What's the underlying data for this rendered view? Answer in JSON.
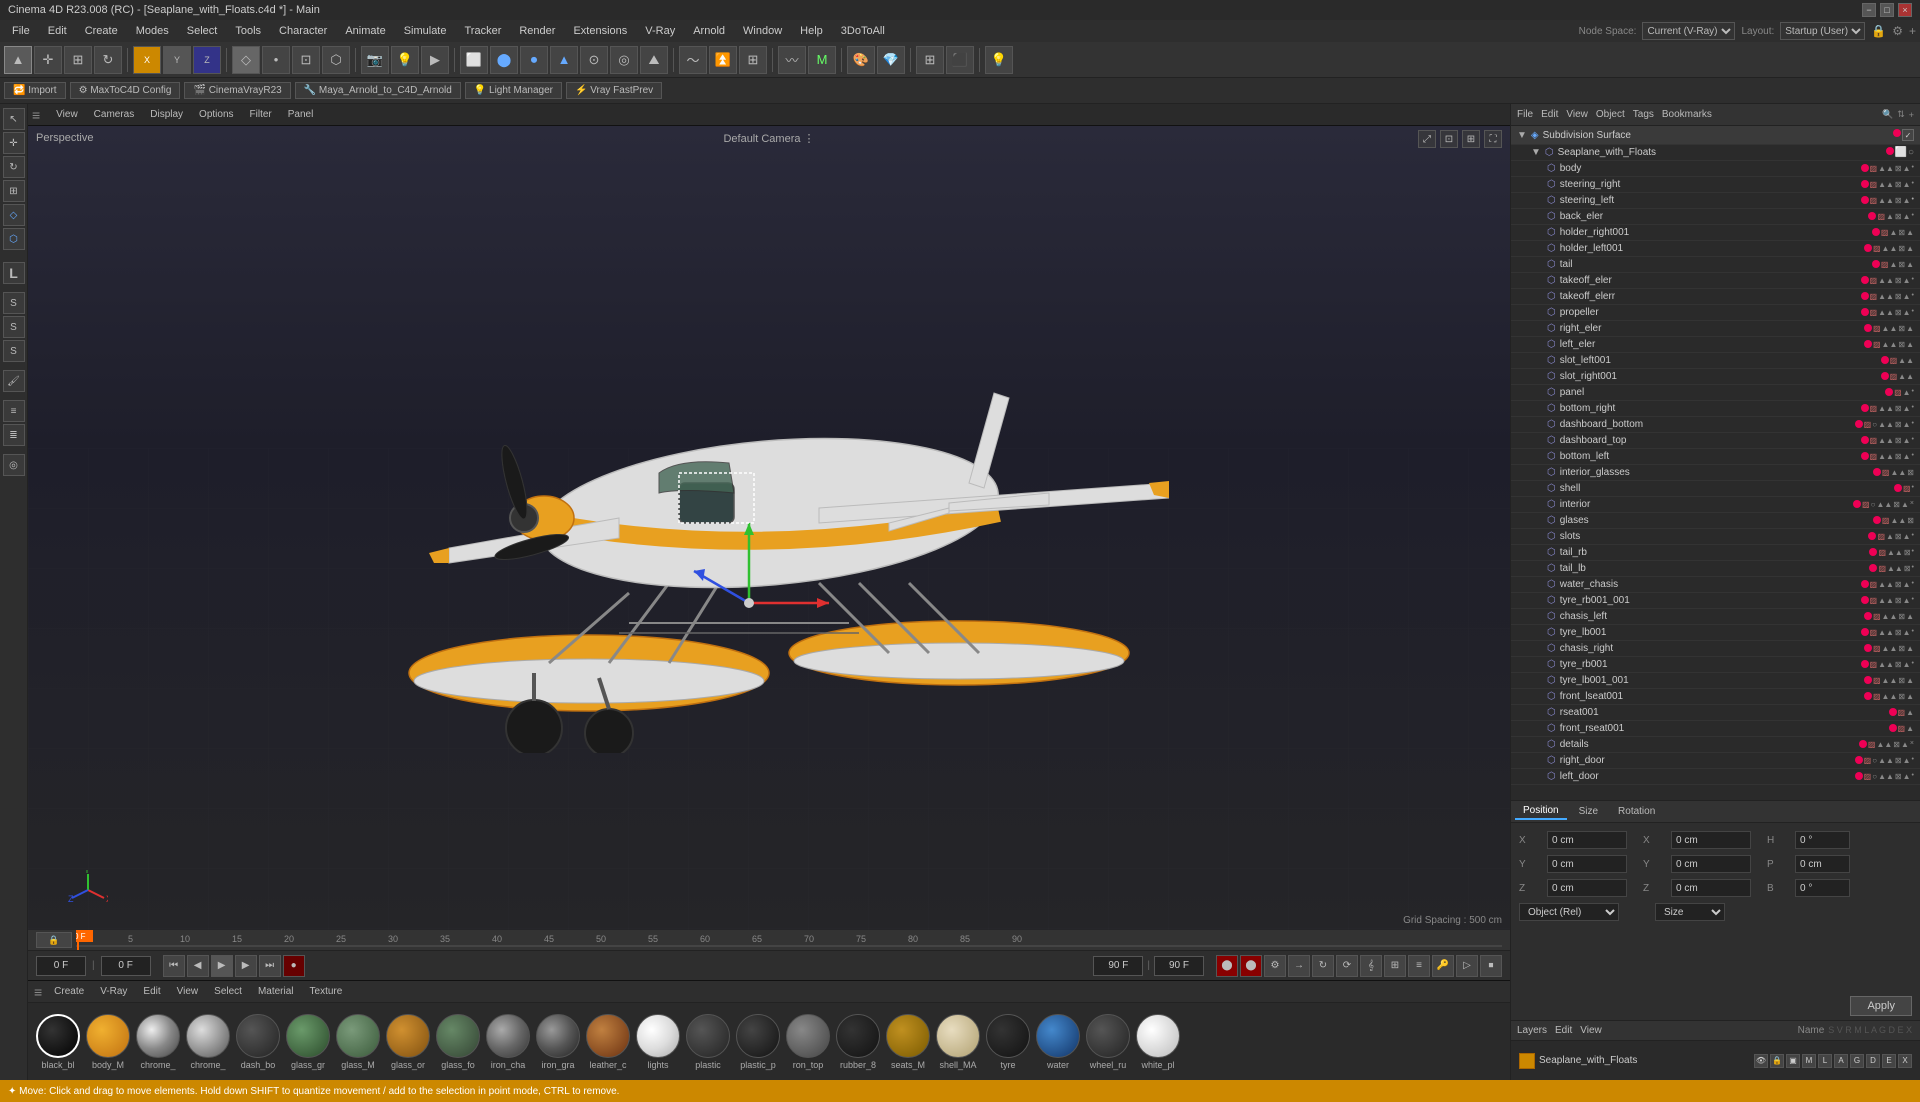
{
  "titlebar": {
    "title": "Cinema 4D R23.008 (RC) - [Seaplane_with_Floats.c4d *] - Main",
    "min": "−",
    "max": "□",
    "close": "×"
  },
  "menubar": {
    "items": [
      "File",
      "Edit",
      "Create",
      "Modes",
      "Select",
      "Tools",
      "Character",
      "Animate",
      "Simulate",
      "Tracker",
      "Render",
      "Extensions",
      "V-Ray",
      "Arnold",
      "Window",
      "Help",
      "3DoToAll"
    ]
  },
  "viewport": {
    "perspective": "Perspective",
    "camera": "Default Camera ⋮",
    "grid_spacing": "Grid Spacing : 500 cm",
    "toolbar": [
      "View",
      "Cameras",
      "Display",
      "Options",
      "Filter",
      "Panel"
    ]
  },
  "node_space": {
    "label": "Node Space:",
    "value": "Current (V-Ray)"
  },
  "layout": {
    "value": "Startup (User)"
  },
  "scene_header": {
    "file": "File",
    "edit": "Edit",
    "view": "View",
    "object": "Object",
    "tags": "Tags",
    "bookmarks": "Bookmarks"
  },
  "scene_root": {
    "name": "Subdivision Surface",
    "child": "Seaplane_with_Floats"
  },
  "scene_items": [
    {
      "name": "body",
      "indent": 2
    },
    {
      "name": "steering_right",
      "indent": 2
    },
    {
      "name": "steering_left",
      "indent": 2
    },
    {
      "name": "back_eler",
      "indent": 2
    },
    {
      "name": "holder_right001",
      "indent": 2
    },
    {
      "name": "holder_left001",
      "indent": 2
    },
    {
      "name": "tail",
      "indent": 2
    },
    {
      "name": "takeoff_eler",
      "indent": 2
    },
    {
      "name": "takeoff_elerr",
      "indent": 2
    },
    {
      "name": "propeller",
      "indent": 2
    },
    {
      "name": "right_eler",
      "indent": 2
    },
    {
      "name": "left_eler",
      "indent": 2
    },
    {
      "name": "slot_left001",
      "indent": 2
    },
    {
      "name": "slot_right001",
      "indent": 2
    },
    {
      "name": "panel",
      "indent": 2
    },
    {
      "name": "bottom_right",
      "indent": 2
    },
    {
      "name": "dashboard_bottom",
      "indent": 2
    },
    {
      "name": "dashboard_top",
      "indent": 2
    },
    {
      "name": "bottom_left",
      "indent": 2
    },
    {
      "name": "interior_glasses",
      "indent": 2
    },
    {
      "name": "shell",
      "indent": 2
    },
    {
      "name": "interior",
      "indent": 2
    },
    {
      "name": "glases",
      "indent": 2
    },
    {
      "name": "slots",
      "indent": 2
    },
    {
      "name": "tail_rb",
      "indent": 2
    },
    {
      "name": "tail_lb",
      "indent": 2
    },
    {
      "name": "water_chasis",
      "indent": 2
    },
    {
      "name": "tyre_rb001_001",
      "indent": 2
    },
    {
      "name": "chasis_left",
      "indent": 2
    },
    {
      "name": "tyre_lb001",
      "indent": 2
    },
    {
      "name": "chasis_right",
      "indent": 2
    },
    {
      "name": "tyre_rb001",
      "indent": 2
    },
    {
      "name": "tyre_lb001_001",
      "indent": 2
    },
    {
      "name": "front_lseat001",
      "indent": 2
    },
    {
      "name": "rseat001",
      "indent": 2
    },
    {
      "name": "front_rseat001",
      "indent": 2
    },
    {
      "name": "details",
      "indent": 2
    },
    {
      "name": "right_door",
      "indent": 2
    },
    {
      "name": "left_door",
      "indent": 2
    }
  ],
  "object_props": {
    "tabs": [
      "Position",
      "Size",
      "Rotation"
    ],
    "position": {
      "x_label": "X",
      "x_val": "0 cm",
      "y_label": "Y",
      "y_val": "0 cm",
      "z_label": "Z",
      "z_val": "0 cm"
    },
    "size": {
      "h_label": "H",
      "h_val": "0 °",
      "p_label": "P",
      "p_val": "0 cm",
      "b_label": "B",
      "b_val": "0 °"
    },
    "coord_dropdown": "Object (Rel)",
    "size_dropdown": "Size",
    "apply_label": "Apply"
  },
  "layers": {
    "tabs": [
      "Layers",
      "Edit",
      "View"
    ],
    "item_name": "Seaplane_with_Floats"
  },
  "materials": {
    "toolbar": [
      "Create",
      "V-Ray",
      "Edit",
      "View",
      "Select",
      "Material",
      "Texture"
    ],
    "items": [
      {
        "name": "black_bl",
        "selected": true,
        "color": "#111"
      },
      {
        "name": "body_M",
        "color": "#e8a020"
      },
      {
        "name": "chrome_",
        "color": "#888"
      },
      {
        "name": "chrome_",
        "color": "#999"
      },
      {
        "name": "dash_bo",
        "color": "#333"
      },
      {
        "name": "glass_gr",
        "color": "#446644"
      },
      {
        "name": "glass_M",
        "color": "#556655"
      },
      {
        "name": "glass_or",
        "color": "#bb8833"
      },
      {
        "name": "glass_fo",
        "color": "#445544"
      },
      {
        "name": "iron_cha",
        "color": "#777"
      },
      {
        "name": "iron_gra",
        "color": "#666"
      },
      {
        "name": "leather_c",
        "color": "#8b5a2b"
      },
      {
        "name": "lights",
        "color": "#ddd"
      },
      {
        "name": "plastic",
        "color": "#333"
      },
      {
        "name": "plastic_p",
        "color": "#222"
      },
      {
        "name": "ron_top",
        "color": "#555"
      },
      {
        "name": "rubber_8",
        "color": "#1a1a1a"
      },
      {
        "name": "seats_M",
        "color": "#8b6914"
      },
      {
        "name": "shell_MA",
        "color": "#d4c8a0"
      },
      {
        "name": "tyre",
        "color": "#1a1a1a"
      },
      {
        "name": "water",
        "color": "#224488"
      },
      {
        "name": "wheel_ru",
        "color": "#333"
      },
      {
        "name": "white_pl",
        "color": "#eee"
      }
    ]
  },
  "timeline": {
    "ticks": [
      "0",
      "5",
      "10",
      "15",
      "20",
      "25",
      "30",
      "35",
      "40",
      "45",
      "50",
      "55",
      "60",
      "65",
      "70",
      "75",
      "80",
      "85",
      "90"
    ],
    "current_frame": "0 F",
    "frame_input": "0 F",
    "frame_input2": "0 F",
    "end_frame": "90 F",
    "end_frame2": "90 F"
  },
  "statusbar": {
    "text": "✦ Move: Click and drag to move elements. Hold down SHIFT to quantize movement / add to the selection in point mode, CTRL to remove."
  },
  "toolbar2": {
    "items": [
      "🔁 Import",
      "⚙ MaxToC4D Config",
      "🎬 CinemaVrayR23",
      "🔧 Maya_Arnold_to_C4D_Arnold",
      "💡 Light Manager",
      "⚡ Vray FastPrev"
    ]
  }
}
